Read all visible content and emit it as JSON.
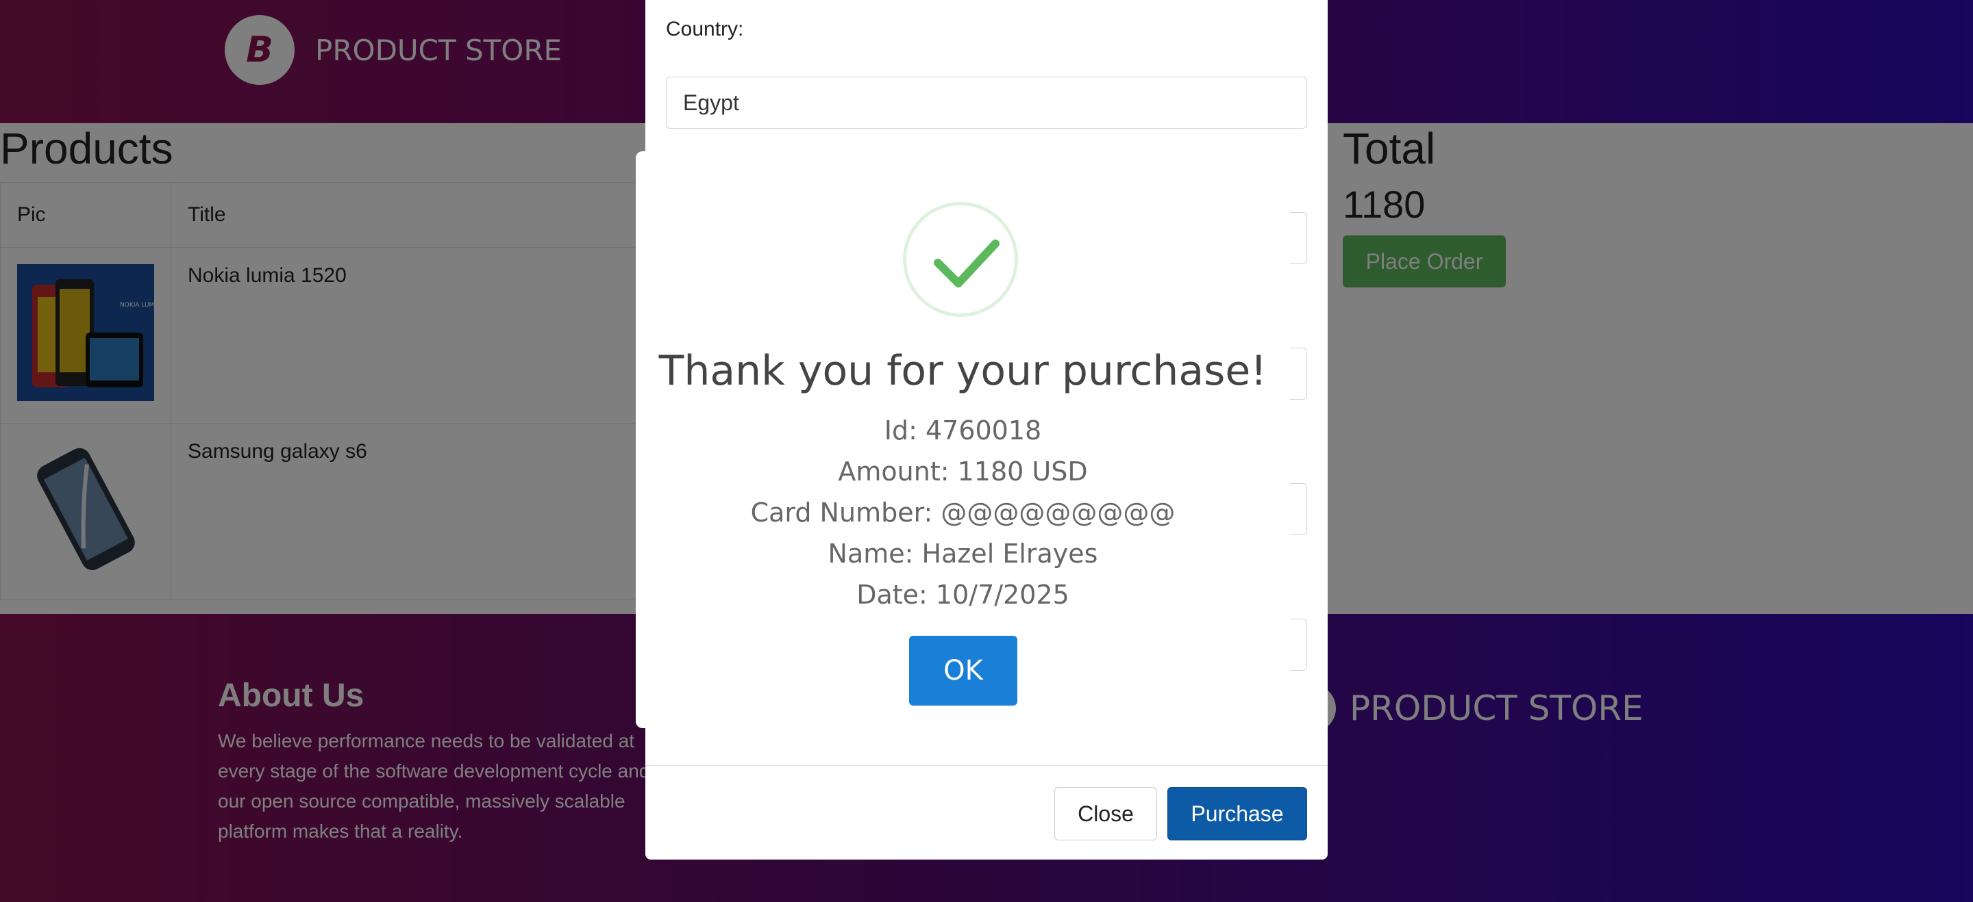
{
  "navbar": {
    "brand_logo_letter": "B",
    "brand_name": "PRODUCT STORE"
  },
  "products": {
    "title": "Products",
    "columns": [
      "Pic",
      "Title"
    ],
    "rows": [
      {
        "pic": "nokia-lumia-image",
        "title": "Nokia lumia 1520"
      },
      {
        "pic": "samsung-galaxy-image",
        "title": "Samsung galaxy s6"
      }
    ]
  },
  "total": {
    "title": "Total",
    "value": "1180",
    "place_order_label": "Place Order"
  },
  "footer": {
    "about_title": "About Us",
    "about_text": "We believe performance needs to be validated at every stage of the software development cycle and our open source compatible, massively scalable platform makes that a reality.",
    "brand_name": "PRODUCT STORE"
  },
  "order_modal": {
    "country_label": "Country:",
    "country_value": "Egypt",
    "close_label": "Close",
    "purchase_label": "Purchase"
  },
  "confirmation": {
    "icon": "checkmark-icon",
    "title": "Thank you for your purchase!",
    "id_line": "Id: 4760018",
    "amount_line": "Amount: 1180 USD",
    "card_line": "Card Number: @@@@@@@@@",
    "name_line": "Name: Hazel Elrayes",
    "date_line": "Date: 10/7/2025",
    "ok_label": "OK",
    "success_color": "#5cb85c",
    "button_color": "#1a7fd6"
  }
}
